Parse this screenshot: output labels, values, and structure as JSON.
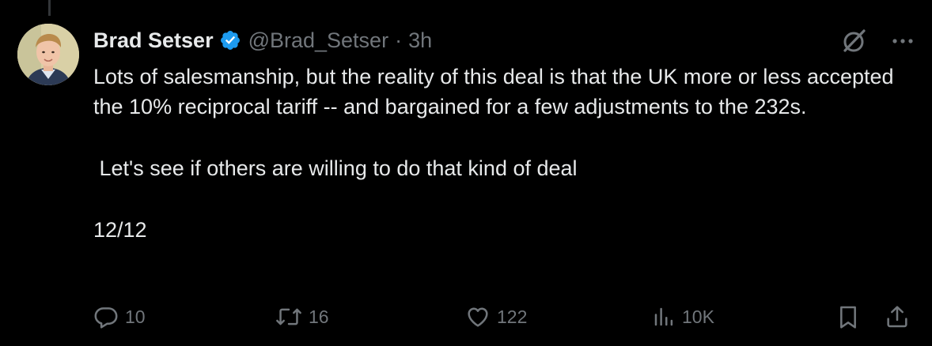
{
  "tweet": {
    "author_name": "Brad Setser",
    "handle": "@Brad_Setser",
    "separator": "·",
    "time": "3h",
    "verified": true,
    "body": [
      "Lots of salesmanship, but the reality of this deal is that the UK more or less accepted the 10% reciprocal tariff -- and bargained for a few adjustments to the 232s.",
      " Let's see if others are willing to do that kind of deal",
      "12/12"
    ]
  },
  "actions": {
    "replies": "10",
    "reposts": "16",
    "likes": "122",
    "views": "10K"
  },
  "icons": {
    "verified": "verified-badge-icon",
    "grok": "grok-icon",
    "more": "more-icon",
    "reply": "reply-icon",
    "repost": "repost-icon",
    "like": "heart-icon",
    "views": "views-icon",
    "bookmark": "bookmark-icon",
    "share": "share-icon"
  },
  "colors": {
    "background": "#000000",
    "text_primary": "#e7e9ea",
    "text_secondary": "#71767b",
    "verified_blue": "#1d9bf0"
  }
}
